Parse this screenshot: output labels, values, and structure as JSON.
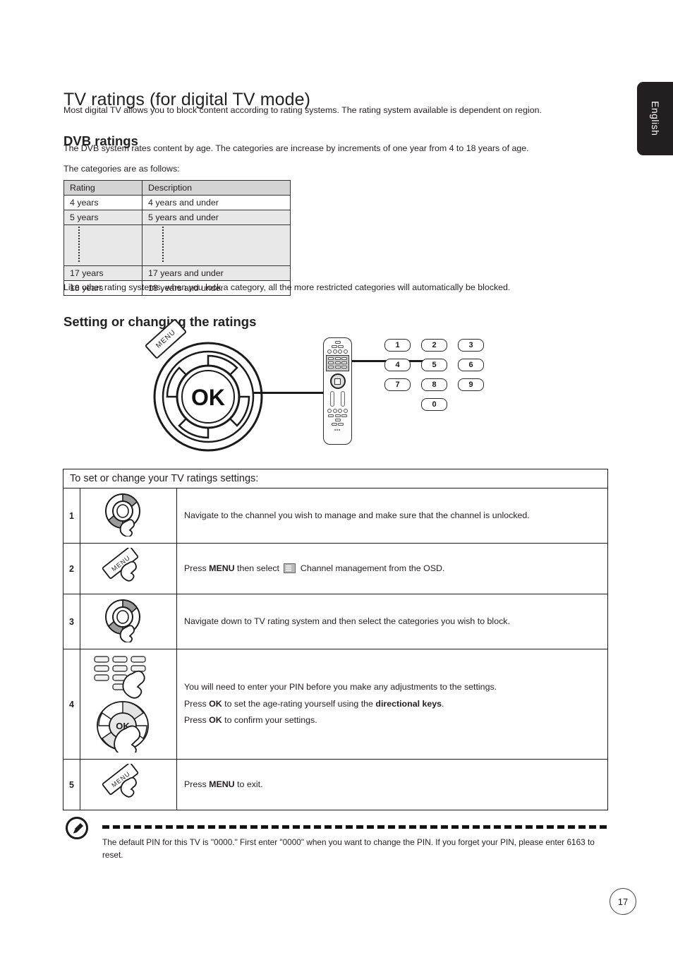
{
  "language_tab": {
    "label": "English"
  },
  "headings": {
    "h1": "TV ratings (for digital TV mode)",
    "dvb": "DVB ratings",
    "setting": "Setting or changing the ratings"
  },
  "paragraphs": {
    "intro": "Most digital TV allows you to block content according to rating systems. The rating system available is dependent on region.",
    "dvb_1": "The DVB system rates content by age. The categories are increase by increments of one year from 4 to 18 years of age.",
    "dvb_2": "The categories are as follows:",
    "like_other": "Like other rating systems, when you lock a category, all the more restricted categories will automatically be blocked."
  },
  "ratings_table": {
    "headers": [
      "Rating",
      "Description"
    ],
    "rows": [
      [
        "4 years",
        "4 years and under"
      ],
      [
        "5 years",
        "5 years and under"
      ],
      [
        "17 years",
        "17 years and under"
      ],
      [
        "18 years",
        "18 years and under"
      ]
    ]
  },
  "illustration": {
    "ok_label": "OK",
    "menu_label": "MENU",
    "keypad": {
      "row1": [
        "1",
        "2",
        "3"
      ],
      "row2": [
        "4",
        "5",
        "6"
      ],
      "row3": [
        "7",
        "8",
        "9"
      ],
      "row4": [
        "0"
      ]
    }
  },
  "steps_table": {
    "title": "To set or change your TV ratings settings:",
    "rows": [
      {
        "number": "1",
        "icon": "nav-wheel-hand-icon",
        "text": "Navigate to the channel you wish to manage and make sure that the channel is unlocked."
      },
      {
        "number": "2",
        "icon": "menu-tag-hand-icon",
        "text_before": "Press ",
        "bold1": "MENU",
        "text_mid": " then select ",
        "inline_icon": "channel-management-osd-icon",
        "text_after": " Channel management from the OSD."
      },
      {
        "number": "3",
        "icon": "nav-wheel-hand-icon",
        "text": "Navigate down to TV rating system and then select the categories you wish to block."
      },
      {
        "number": "4",
        "icon": "keypad-and-ok-wheel-hand-icon",
        "line1": "You will need to enter your PIN before you make any adjustments to the settings.",
        "line2_a": "Press ",
        "line2_b": "OK",
        "line2_c": " to set the age-rating yourself using the ",
        "line2_d": "directional keys",
        "line2_e": ".",
        "line3_a": "Press ",
        "line3_b": "OK",
        "line3_c": " to confirm your settings."
      },
      {
        "number": "5",
        "icon": "menu-tag-hand-icon",
        "text_before": "Press ",
        "bold1": "MENU",
        "text_after": " to exit."
      }
    ]
  },
  "note": {
    "icon": "note-pointer-icon",
    "text": "The default PIN for this TV is \"0000.\" First enter \"0000\" when you want to change the PIN. If you forget your PIN, please enter 6163 to reset."
  },
  "page_number": "17",
  "colors": {
    "tab_background": "#231f20",
    "table_header_fill": "#d4d4d4",
    "table_shade_fill": "#e8e8e8",
    "text": "#231f20"
  }
}
